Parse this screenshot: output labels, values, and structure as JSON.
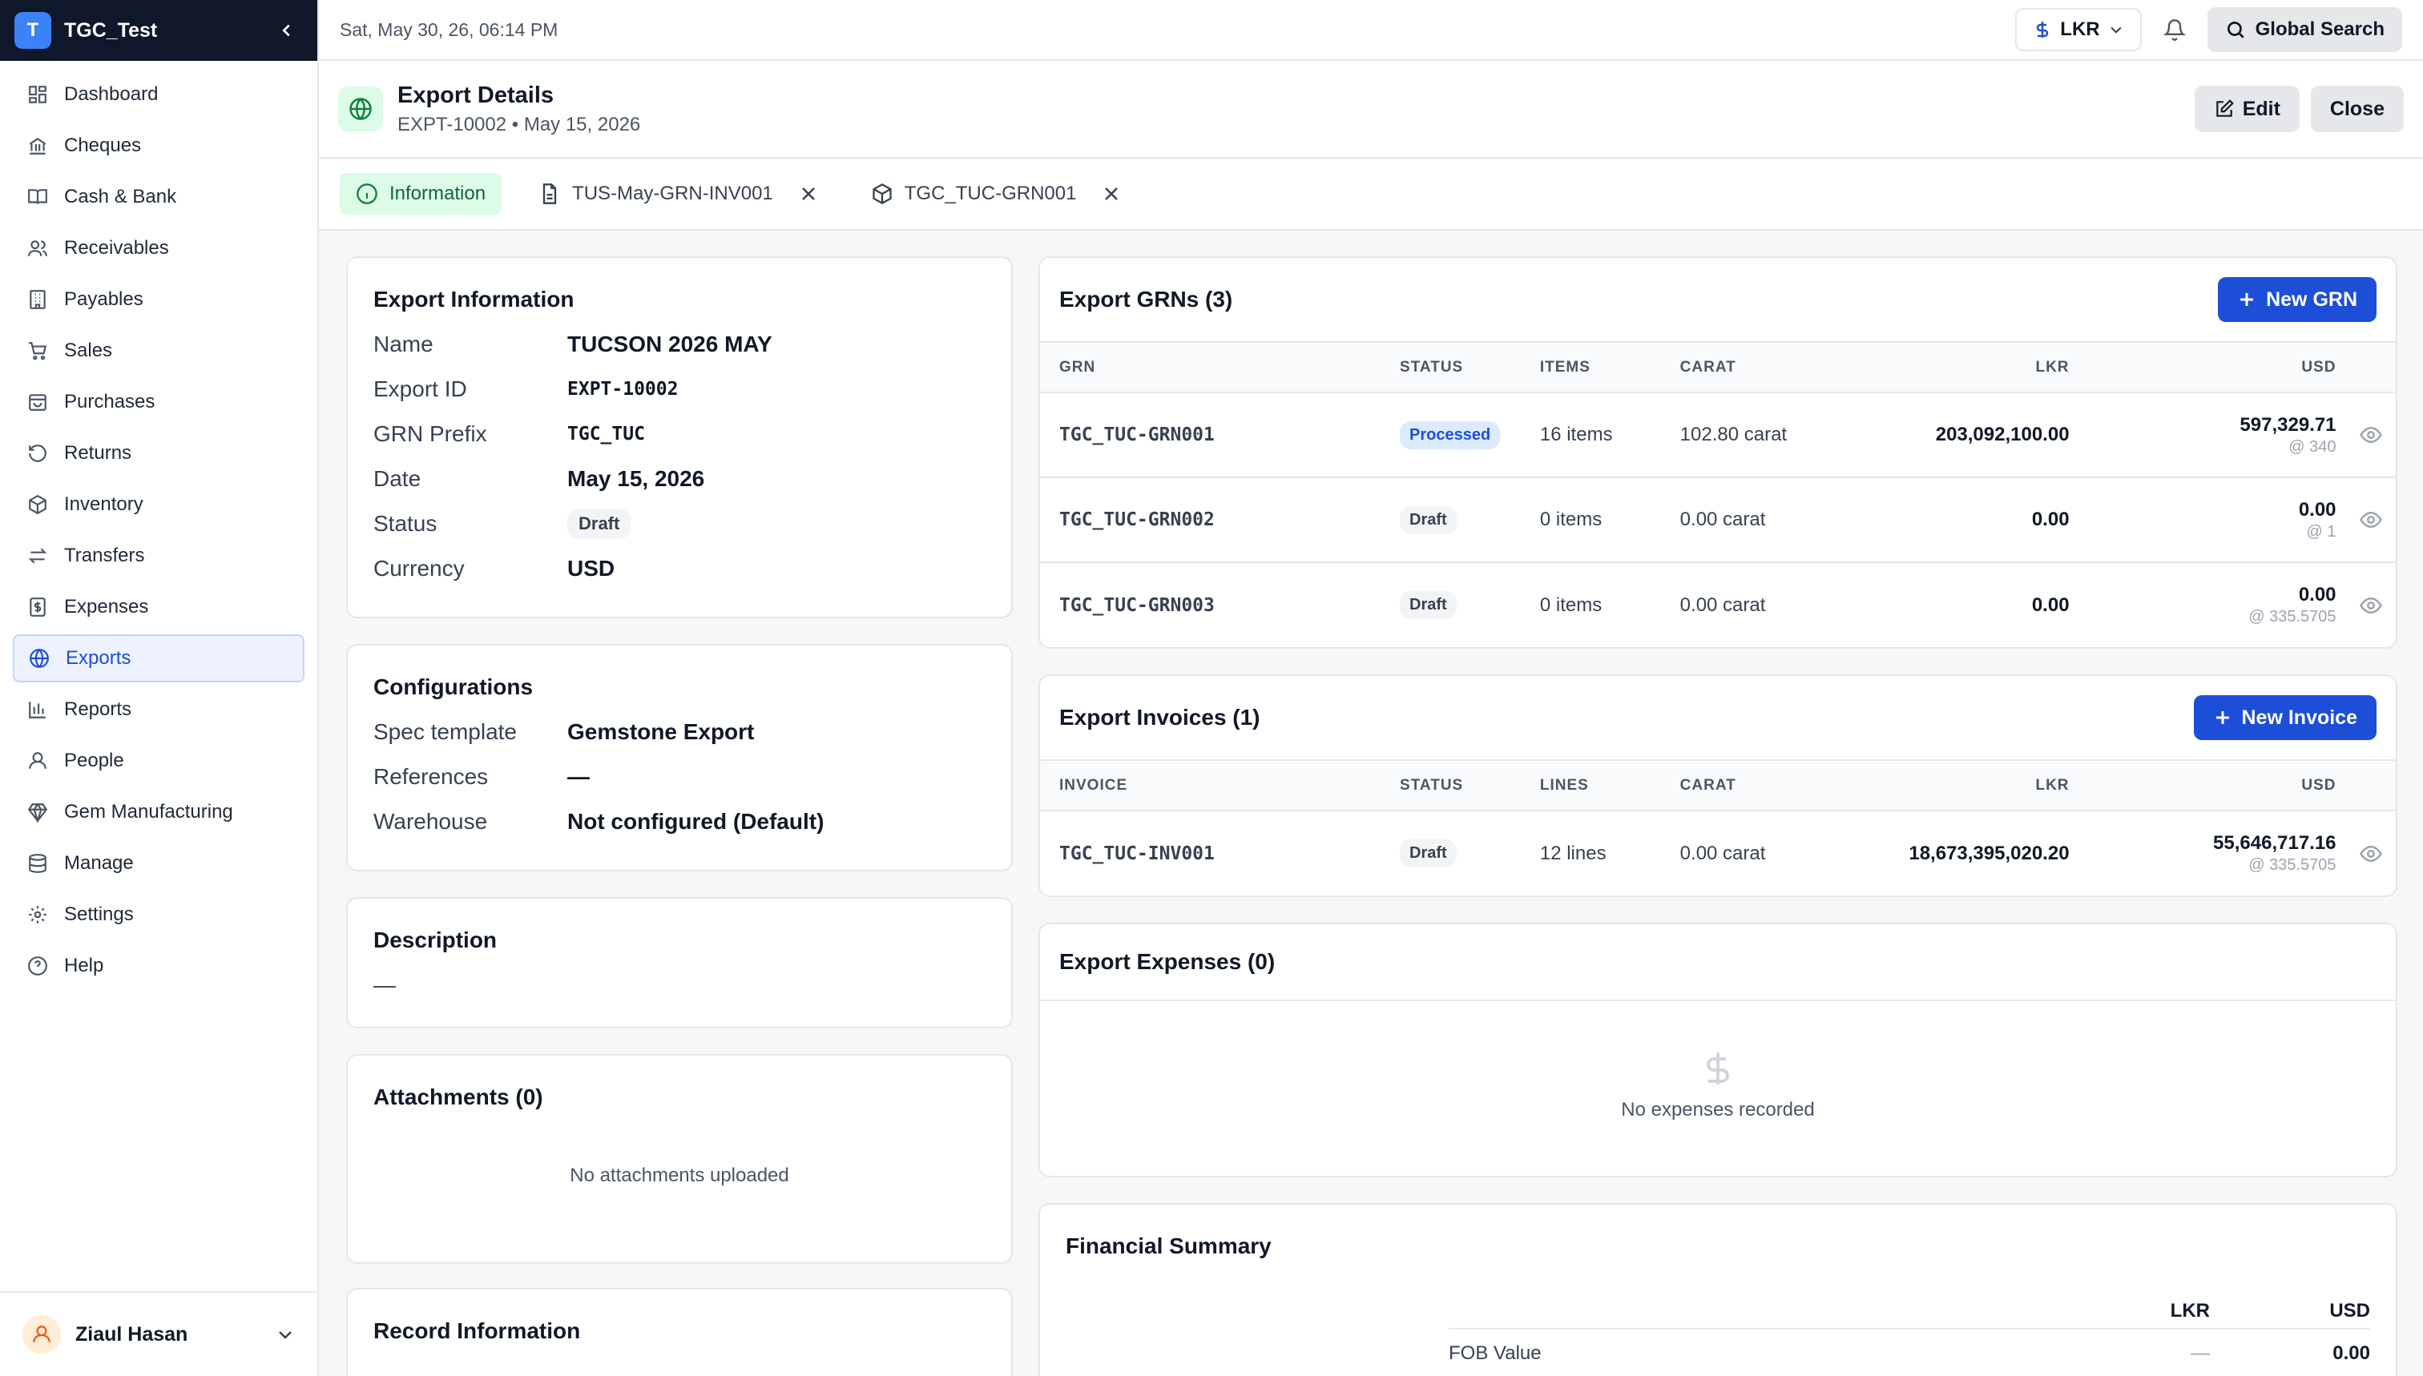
{
  "app": {
    "badge": "T",
    "name": "TGC_Test"
  },
  "sidebar": {
    "items": [
      {
        "label": "Dashboard"
      },
      {
        "label": "Cheques"
      },
      {
        "label": "Cash & Bank"
      },
      {
        "label": "Receivables"
      },
      {
        "label": "Payables"
      },
      {
        "label": "Sales"
      },
      {
        "label": "Purchases"
      },
      {
        "label": "Returns"
      },
      {
        "label": "Inventory"
      },
      {
        "label": "Transfers"
      },
      {
        "label": "Expenses"
      },
      {
        "label": "Exports"
      },
      {
        "label": "Reports"
      },
      {
        "label": "People"
      },
      {
        "label": "Gem Manufacturing"
      },
      {
        "label": "Manage"
      },
      {
        "label": "Settings"
      },
      {
        "label": "Help"
      }
    ],
    "active": "Exports",
    "user": "Ziaul Hasan"
  },
  "topbar": {
    "datetime": "Sat, May 30, 26, 06:14 PM",
    "currency": "LKR",
    "search": "Global Search"
  },
  "header": {
    "title": "Export Details",
    "subtitle": "EXPT-10002 • May 15, 2026",
    "edit": "Edit",
    "close": "Close"
  },
  "tabs": [
    {
      "label": "Information"
    },
    {
      "label": "TUS-May-GRN-INV001"
    },
    {
      "label": "TGC_TUC-GRN001"
    }
  ],
  "export_info": {
    "title": "Export Information",
    "rows": [
      {
        "k": "Name",
        "v": "TUCSON 2026 MAY"
      },
      {
        "k": "Export ID",
        "v": "EXPT-10002"
      },
      {
        "k": "GRN Prefix",
        "v": "TGC_TUC"
      },
      {
        "k": "Date",
        "v": "May 15, 2026"
      },
      {
        "k": "Status",
        "v": "Draft"
      },
      {
        "k": "Currency",
        "v": "USD"
      }
    ]
  },
  "config": {
    "title": "Configurations",
    "rows": [
      {
        "k": "Spec template",
        "v": "Gemstone Export"
      },
      {
        "k": "References",
        "v": "—"
      },
      {
        "k": "Warehouse",
        "v": "Not configured (Default)"
      }
    ]
  },
  "description": {
    "title": "Description",
    "value": "—"
  },
  "attachments": {
    "title": "Attachments (0)",
    "empty": "No attachments uploaded"
  },
  "record": {
    "title": "Record Information"
  },
  "grns": {
    "title": "Export GRNs (3)",
    "new_label": "New GRN",
    "headers": [
      "GRN",
      "STATUS",
      "ITEMS",
      "CARAT",
      "LKR",
      "USD"
    ],
    "rows": [
      {
        "id": "TGC_TUC-GRN001",
        "status": "Processed",
        "items": "16 items",
        "carat": "102.80 carat",
        "lkr": "203,092,100.00",
        "usd": "597,329.71",
        "rate": "@ 340"
      },
      {
        "id": "TGC_TUC-GRN002",
        "status": "Draft",
        "items": "0 items",
        "carat": "0.00 carat",
        "lkr": "0.00",
        "usd": "0.00",
        "rate": "@ 1"
      },
      {
        "id": "TGC_TUC-GRN003",
        "status": "Draft",
        "items": "0 items",
        "carat": "0.00 carat",
        "lkr": "0.00",
        "usd": "0.00",
        "rate": "@ 335.5705"
      }
    ]
  },
  "invoices": {
    "title": "Export Invoices (1)",
    "new_label": "New Invoice",
    "headers": [
      "INVOICE",
      "STATUS",
      "LINES",
      "CARAT",
      "LKR",
      "USD"
    ],
    "rows": [
      {
        "id": "TGC_TUC-INV001",
        "status": "Draft",
        "lines": "12 lines",
        "carat": "0.00 carat",
        "lkr": "18,673,395,020.20",
        "usd": "55,646,717.16",
        "rate": "@ 335.5705"
      }
    ]
  },
  "expenses": {
    "title": "Export Expenses (0)",
    "empty": "No expenses recorded"
  },
  "financial": {
    "title": "Financial Summary",
    "headers": [
      "LKR",
      "USD"
    ],
    "rows": [
      {
        "label": "FOB Value",
        "lkr": "—",
        "usd": "0.00"
      }
    ]
  },
  "colors": {
    "primary": "#1d4ed8",
    "brand_dark": "#0f172a",
    "success_bg": "#dcfce7"
  }
}
